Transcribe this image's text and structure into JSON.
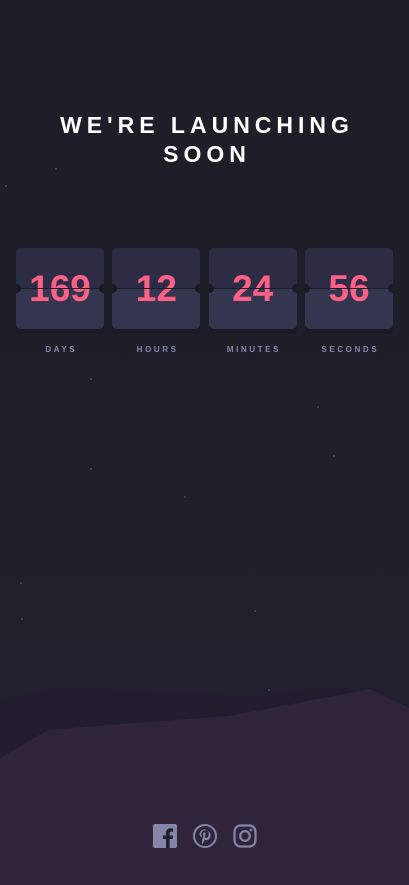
{
  "title": {
    "line1": "WE'RE LAUNCHING",
    "line2": "SOON"
  },
  "countdown": [
    {
      "value": "169",
      "label": "DAYS"
    },
    {
      "value": "12",
      "label": "HOURS"
    },
    {
      "value": "24",
      "label": "MINUTES"
    },
    {
      "value": "56",
      "label": "SECONDS"
    }
  ],
  "colors": {
    "background": "#1e1f29",
    "card": "#34364f",
    "digits": "#fb6087",
    "label": "#8486a9",
    "hills": "#2f2439",
    "icons": "#8486a9"
  },
  "social": [
    {
      "icon": "facebook-icon"
    },
    {
      "icon": "pinterest-icon"
    },
    {
      "icon": "instagram-icon"
    }
  ]
}
